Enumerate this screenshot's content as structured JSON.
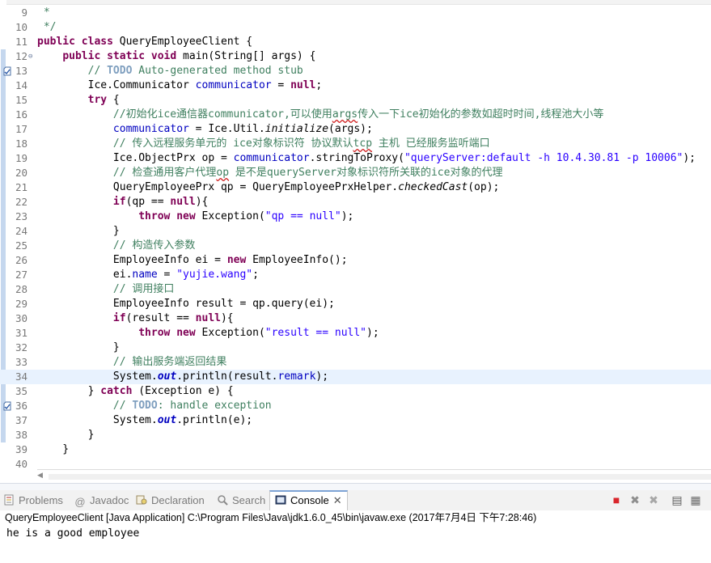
{
  "editor": {
    "lines": [
      {
        "n": "9",
        "tokens": [
          {
            "t": " *",
            "c": "c"
          }
        ]
      },
      {
        "n": "10",
        "tokens": [
          {
            "t": " */",
            "c": "c"
          }
        ]
      },
      {
        "n": "11",
        "tokens": [
          {
            "t": "public",
            "c": "k"
          },
          {
            "t": " "
          },
          {
            "t": "class",
            "c": "k"
          },
          {
            "t": " QueryEmployeeClient {"
          }
        ]
      },
      {
        "n": "12",
        "fold": true,
        "tokens": [
          {
            "t": "    "
          },
          {
            "t": "public",
            "c": "k"
          },
          {
            "t": " "
          },
          {
            "t": "static",
            "c": "k"
          },
          {
            "t": " "
          },
          {
            "t": "void",
            "c": "k"
          },
          {
            "t": " main(String[] args) {"
          }
        ]
      },
      {
        "n": "13",
        "task": true,
        "tokens": [
          {
            "t": "        "
          },
          {
            "t": "// ",
            "c": "c"
          },
          {
            "t": "TODO",
            "c": "t"
          },
          {
            "t": " Auto-generated method stub",
            "c": "c"
          }
        ]
      },
      {
        "n": "14",
        "tokens": [
          {
            "t": "        Ice.Communicator "
          },
          {
            "t": "communicator",
            "c": "f"
          },
          {
            "t": " = "
          },
          {
            "t": "null",
            "c": "k"
          },
          {
            "t": ";"
          }
        ]
      },
      {
        "n": "15",
        "tokens": [
          {
            "t": "        "
          },
          {
            "t": "try",
            "c": "k"
          },
          {
            "t": " {"
          }
        ]
      },
      {
        "n": "16",
        "tokens": [
          {
            "t": "            "
          },
          {
            "t": "//初始化ice通信器communicator,可以使用",
            "c": "c"
          },
          {
            "t": "args",
            "c": "c u"
          },
          {
            "t": "传入一下ice初始化的参数如超时时间,线程池大小等",
            "c": "c"
          }
        ]
      },
      {
        "n": "17",
        "tokens": [
          {
            "t": "            "
          },
          {
            "t": "communicator",
            "c": "f"
          },
          {
            "t": " = Ice.Util."
          },
          {
            "t": "initialize",
            "c": "i"
          },
          {
            "t": "(args);"
          }
        ]
      },
      {
        "n": "18",
        "tokens": [
          {
            "t": "            "
          },
          {
            "t": "// 传入远程服务单元的 ice对象标识符 协议默认",
            "c": "c"
          },
          {
            "t": "tcp",
            "c": "c u"
          },
          {
            "t": " 主机 已经服务监听端口",
            "c": "c"
          }
        ]
      },
      {
        "n": "19",
        "tokens": [
          {
            "t": "            Ice.ObjectPrx op = "
          },
          {
            "t": "communicator",
            "c": "f"
          },
          {
            "t": ".stringToProxy("
          },
          {
            "t": "\"queryServer:default -h 10.4.30.81 -p 10006\"",
            "c": "s"
          },
          {
            "t": ");"
          }
        ]
      },
      {
        "n": "20",
        "tokens": [
          {
            "t": "            "
          },
          {
            "t": "// 检查通用客户代理",
            "c": "c"
          },
          {
            "t": "op",
            "c": "c u"
          },
          {
            "t": " 是不是queryServer对象标识符所关联的ice对象的代理",
            "c": "c"
          }
        ]
      },
      {
        "n": "21",
        "tokens": [
          {
            "t": "            QueryEmployeePrx qp = QueryEmployeePrxHelper."
          },
          {
            "t": "checkedCast",
            "c": "i"
          },
          {
            "t": "(op);"
          }
        ]
      },
      {
        "n": "22",
        "tokens": [
          {
            "t": "            "
          },
          {
            "t": "if",
            "c": "k"
          },
          {
            "t": "(qp == "
          },
          {
            "t": "null",
            "c": "k"
          },
          {
            "t": "){"
          }
        ]
      },
      {
        "n": "23",
        "tokens": [
          {
            "t": "                "
          },
          {
            "t": "throw",
            "c": "k"
          },
          {
            "t": " "
          },
          {
            "t": "new",
            "c": "k"
          },
          {
            "t": " Exception("
          },
          {
            "t": "\"qp == null\"",
            "c": "s"
          },
          {
            "t": ");"
          }
        ]
      },
      {
        "n": "24",
        "tokens": [
          {
            "t": "            }"
          }
        ]
      },
      {
        "n": "25",
        "tokens": [
          {
            "t": "            "
          },
          {
            "t": "// 构造传入参数",
            "c": "c"
          }
        ]
      },
      {
        "n": "26",
        "tokens": [
          {
            "t": "            EmployeeInfo ei = "
          },
          {
            "t": "new",
            "c": "k"
          },
          {
            "t": " EmployeeInfo();"
          }
        ]
      },
      {
        "n": "27",
        "tokens": [
          {
            "t": "            ei."
          },
          {
            "t": "name",
            "c": "f"
          },
          {
            "t": " = "
          },
          {
            "t": "\"yujie.wang\"",
            "c": "s"
          },
          {
            "t": ";"
          }
        ]
      },
      {
        "n": "28",
        "tokens": [
          {
            "t": "            "
          },
          {
            "t": "// 调用接口",
            "c": "c"
          }
        ]
      },
      {
        "n": "29",
        "tokens": [
          {
            "t": "            EmployeeInfo result = qp.query(ei);"
          }
        ]
      },
      {
        "n": "30",
        "tokens": [
          {
            "t": "            "
          },
          {
            "t": "if",
            "c": "k"
          },
          {
            "t": "(result == "
          },
          {
            "t": "null",
            "c": "k"
          },
          {
            "t": "){"
          }
        ]
      },
      {
        "n": "31",
        "tokens": [
          {
            "t": "                "
          },
          {
            "t": "throw",
            "c": "k"
          },
          {
            "t": " "
          },
          {
            "t": "new",
            "c": "k"
          },
          {
            "t": " Exception("
          },
          {
            "t": "\"result == null\"",
            "c": "s"
          },
          {
            "t": ");"
          }
        ]
      },
      {
        "n": "32",
        "tokens": [
          {
            "t": "            }"
          }
        ]
      },
      {
        "n": "33",
        "tokens": [
          {
            "t": "            "
          },
          {
            "t": "// 输出服务端返回结果",
            "c": "c"
          }
        ]
      },
      {
        "n": "34",
        "current": true,
        "tokens": [
          {
            "t": "            System."
          },
          {
            "t": "out",
            "c": "sf"
          },
          {
            "t": ".println(result."
          },
          {
            "t": "remark",
            "c": "f"
          },
          {
            "t": ");"
          }
        ]
      },
      {
        "n": "35",
        "tokens": [
          {
            "t": "        } "
          },
          {
            "t": "catch",
            "c": "k"
          },
          {
            "t": " (Exception e) {"
          }
        ]
      },
      {
        "n": "36",
        "task": true,
        "tokens": [
          {
            "t": "            "
          },
          {
            "t": "// ",
            "c": "c"
          },
          {
            "t": "TODO",
            "c": "t"
          },
          {
            "t": ": handle exception",
            "c": "c"
          }
        ]
      },
      {
        "n": "37",
        "tokens": [
          {
            "t": "            System."
          },
          {
            "t": "out",
            "c": "sf"
          },
          {
            "t": ".println(e);"
          }
        ]
      },
      {
        "n": "38",
        "tokens": [
          {
            "t": "        }"
          }
        ]
      },
      {
        "n": "39",
        "tokens": [
          {
            "t": "    }"
          }
        ]
      },
      {
        "n": "40",
        "tokens": []
      }
    ]
  },
  "tabs": [
    {
      "name": "problems",
      "label": "Problems",
      "icon": "problems-icon"
    },
    {
      "name": "javadoc",
      "label": "Javadoc",
      "icon": "at-icon",
      "glyph": "@"
    },
    {
      "name": "declaration",
      "label": "Declaration",
      "icon": "declaration-icon"
    },
    {
      "name": "search",
      "label": "Search",
      "icon": "search-icon"
    },
    {
      "name": "console",
      "label": "Console",
      "icon": "console-icon",
      "active": true,
      "close": "✕"
    }
  ],
  "toolbar": [
    {
      "name": "terminate-icon",
      "glyph": "■",
      "color": "#d9262c"
    },
    {
      "name": "remove-launch-icon",
      "glyph": "✖",
      "color": "#8e8e8e"
    },
    {
      "name": "remove-all-launches-icon",
      "glyph": "✖",
      "color": "#a7a7a7"
    },
    {
      "name": "clear-console-icon",
      "glyph": "▤",
      "color": "#5e5e5e"
    },
    {
      "name": "scroll-lock-icon",
      "glyph": "▦",
      "color": "#6b6b6b"
    }
  ],
  "console": {
    "status": "QueryEmployeeClient [Java Application] C:\\Program Files\\Java\\jdk1.6.0_45\\bin\\javaw.exe (2017年7月4日 下午7:28:46)",
    "output": "he is a good employee"
  },
  "colors": {
    "keyword": "#7f0055",
    "comment": "#3f7f5f",
    "string": "#2a00ff",
    "field": "#0000c0",
    "current_line": "#e8f2fe",
    "active_tab_border": "#7da3d5"
  }
}
